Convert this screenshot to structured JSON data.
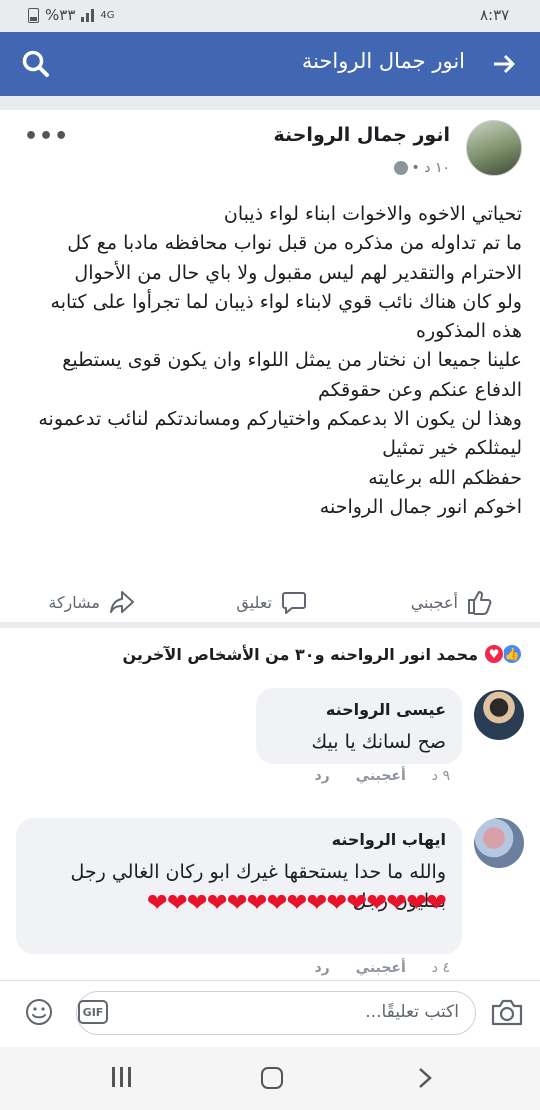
{
  "status_bar": {
    "time": "٨:٣٧",
    "battery": "%٣٣",
    "network": "4G"
  },
  "header": {
    "title": "انور جمال الرواحنة",
    "back_icon": "arrow-right-icon",
    "search_icon": "search-icon",
    "background": "#4267b2"
  },
  "post": {
    "author": "انور جمال الرواحنة",
    "time": "١٠ د •",
    "privacy_icon": "globe-icon",
    "lines": [
      "تحياتي الاخوه والاخوات ابناء لواء ذيبان",
      "ما تم تداوله من مذكره من قبل نواب محافظه مادبا مع كل",
      "الاحترام والتقدير لهم ليس مقبول ولا باي حال من الأحوال",
      "ولو كان هناك نائب قوي لابناء لواء ذيبان لما تجرأوا على كتابه",
      "هذه المذكوره",
      "علينا جميعا ان نختار من يمثل اللواء وان يكون قوى يستطيع",
      "الدفاع عنكم وعن حقوقكم",
      "وهذا لن يكون الا بدعمكم واختياركم ومساندتكم لنائب تدعمونه",
      "ليمثلكم خير تمثيل",
      "حفظكم الله برعايته",
      "اخوكم انور جمال الرواحنه"
    ],
    "actions": {
      "like": "أعجبني",
      "comment": "تعليق",
      "share": "مشاركة"
    }
  },
  "reactions": {
    "summary": "محمد انور الرواحنه و٣٠ من الأشخاص الآخرين"
  },
  "comments": [
    {
      "name": "عيسى الرواحنه",
      "lines": [
        "صح لسانك يا بيك"
      ],
      "time": "٩ د",
      "like": "أعجبني",
      "reply": "رد"
    },
    {
      "name": "ايهاب الرواحنه",
      "lines": [
        "والله ما حدا يستحقها غيرك ابو ركان الغالي رجل",
        "بمليون رجل"
      ],
      "hearts": "❤❤❤❤❤❤❤❤❤❤❤❤❤❤❤",
      "time": "٤ د",
      "like": "أعجبني",
      "reply": "رد"
    }
  ],
  "composer": {
    "placeholder": "اكتب تعليقًا...",
    "gif": "GIF"
  }
}
